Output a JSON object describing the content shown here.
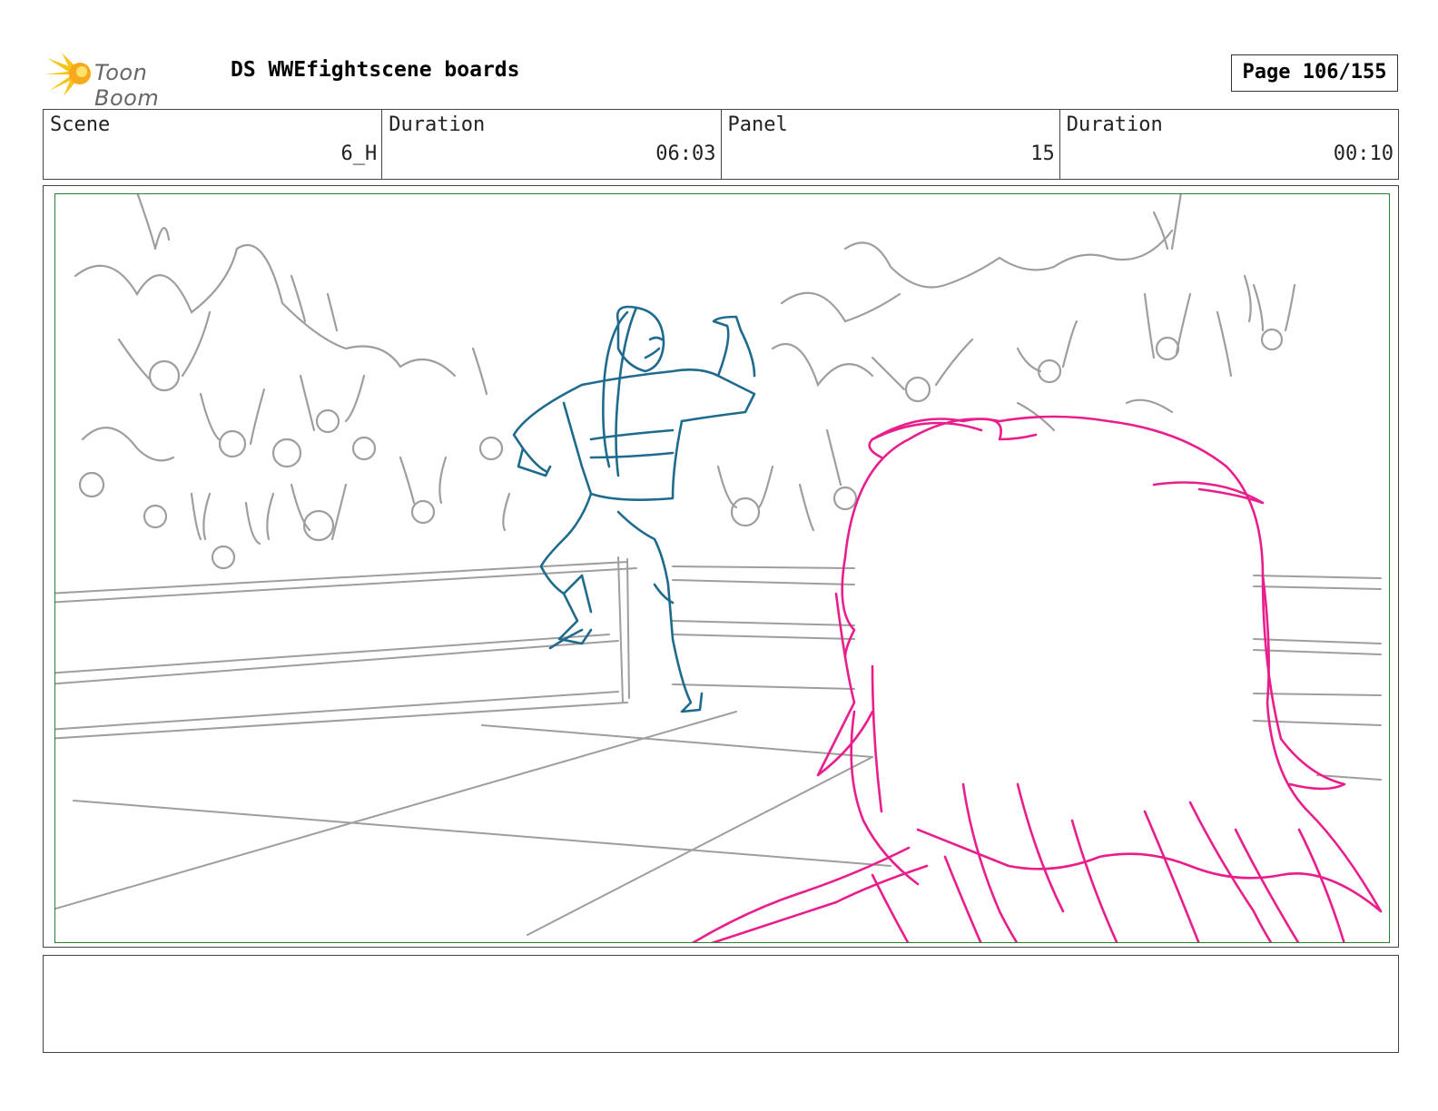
{
  "header": {
    "logo_text": "Toon Boom",
    "title": "DS WWEfightscene boards",
    "page": "Page 106/155"
  },
  "fields": {
    "scene_label": "Scene",
    "scene_value": "6_H",
    "duration_label": "Duration",
    "duration_value": "06:03",
    "panel_label": "Panel",
    "panel_value": "15",
    "panel_duration_label": "Duration",
    "panel_duration_value": "00:10"
  },
  "colors": {
    "frame_border": "#2e7d32",
    "crowd_sketch": "#9e9e9e",
    "wrestler_sketch": "#1f6b8e",
    "foreground_sketch": "#e91e8c"
  },
  "notes": ""
}
